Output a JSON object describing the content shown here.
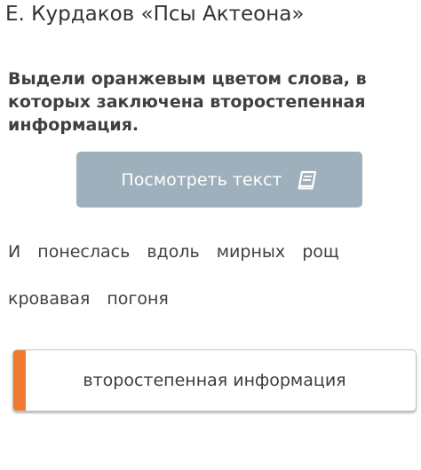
{
  "header": {
    "title": "Е. Курдаков «Псы Актеона»"
  },
  "task": {
    "prompt": "Выдели оранжевым цветом слова, в которых заключена второстепенная информация."
  },
  "show_text_button": {
    "label": "Посмотреть текст",
    "icon": "book-icon"
  },
  "sentence": {
    "line1": [
      "И",
      "понеслась",
      "вдоль",
      "мирных",
      "рощ"
    ],
    "line2": [
      "кровавая",
      "погоня"
    ]
  },
  "answer_option": {
    "label": "второстепенная информация",
    "marker_color": "#f07b30"
  },
  "colors": {
    "button_bg": "#9db0bc",
    "accent_orange": "#f07b30"
  }
}
